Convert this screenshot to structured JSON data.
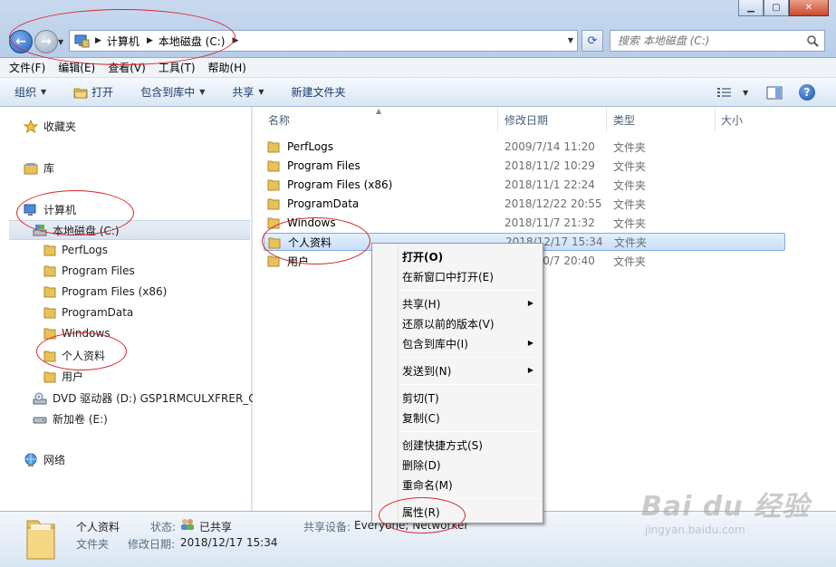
{
  "address": {
    "segments": [
      "计算机",
      "本地磁盘 (C:)"
    ],
    "search_placeholder": "搜索 本地磁盘 (C:)"
  },
  "menu": [
    "文件(F)",
    "编辑(E)",
    "查看(V)",
    "工具(T)",
    "帮助(H)"
  ],
  "toolbar": {
    "organize": "组织",
    "open": "打开",
    "include": "包含到库中",
    "share": "共享",
    "new_folder": "新建文件夹"
  },
  "nav": {
    "favorites": "收藏夹",
    "libraries": "库",
    "computer": "计算机",
    "local_disk": "本地磁盘 (C:)",
    "folders": [
      "PerfLogs",
      "Program Files",
      "Program Files (x86)",
      "ProgramData",
      "Windows",
      "个人资料",
      "用户"
    ],
    "dvd": "DVD 驱动器 (D:) GSP1RMCULXFRER_C",
    "new_volume": "新加卷 (E:)",
    "network": "网络"
  },
  "columns": {
    "name": "名称",
    "date": "修改日期",
    "type": "类型",
    "size": "大小"
  },
  "files": [
    {
      "name": "PerfLogs",
      "date": "2009/7/14 11:20",
      "type": "文件夹"
    },
    {
      "name": "Program Files",
      "date": "2018/11/2 10:29",
      "type": "文件夹"
    },
    {
      "name": "Program Files (x86)",
      "date": "2018/11/1 22:24",
      "type": "文件夹"
    },
    {
      "name": "ProgramData",
      "date": "2018/12/22 20:55",
      "type": "文件夹"
    },
    {
      "name": "Windows",
      "date": "2018/11/7 21:32",
      "type": "文件夹"
    },
    {
      "name": "个人资料",
      "date": "2018/12/17 15:34",
      "type": "文件夹"
    },
    {
      "name": "用户",
      "date": "2018/10/7 20:40",
      "type": "文件夹"
    }
  ],
  "context_menu": {
    "open": "打开(O)",
    "open_new_window": "在新窗口中打开(E)",
    "share": "共享(H)",
    "restore": "还原以前的版本(V)",
    "include": "包含到库中(I)",
    "send_to": "发送到(N)",
    "cut": "剪切(T)",
    "copy": "复制(C)",
    "create_shortcut": "创建快捷方式(S)",
    "delete": "删除(D)",
    "rename": "重命名(M)",
    "properties": "属性(R)"
  },
  "details": {
    "name": "个人资料",
    "kind": "文件夹",
    "state_label": "状态:",
    "state_value": "已共享",
    "modified_label": "修改日期:",
    "modified_value": "2018/12/17 15:34",
    "shared_with_label": "共享设备:",
    "shared_with_value": "Everyone; Networker"
  },
  "watermark": {
    "main": "Bai du 经验",
    "sub": "jingyan.baidu.com"
  }
}
